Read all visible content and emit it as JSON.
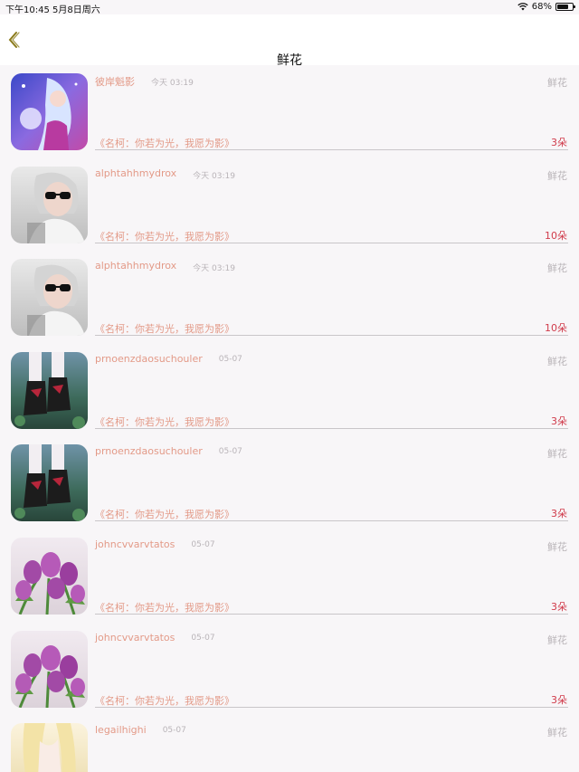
{
  "status_bar": {
    "time": "下午10:45  5月8日周六",
    "battery": "68%",
    "battery_level": 0.68
  },
  "nav": {
    "title": "鲜花",
    "back_icon": "chevron-left-icon",
    "accent_color": "#8a7a1a"
  },
  "colors": {
    "username": "#e39a88",
    "muted": "#b9b4b8",
    "count": "#d03a4a"
  },
  "items": [
    {
      "user": "彼岸魁影",
      "time": "今天 03:19",
      "gift": "鲜花",
      "message": "《名柯：你若为光，我愿为影》",
      "count": "3朵",
      "avatar": "anime-girl-avatar"
    },
    {
      "user": "alphtahhmydrox",
      "time": "今天 03:19",
      "gift": "鲜花",
      "message": "《名柯：你若为光，我愿为影》",
      "count": "10朵",
      "avatar": "sunglasses-boy-avatar"
    },
    {
      "user": "alphtahhmydrox",
      "time": "今天 03:19",
      "gift": "鲜花",
      "message": "《名柯：你若为光，我愿为影》",
      "count": "10朵",
      "avatar": "sunglasses-boy-avatar"
    },
    {
      "user": "prnoenzdaosuchouler",
      "time": "05-07",
      "gift": "鲜花",
      "message": "《名柯：你若为光，我愿为影》",
      "count": "3朵",
      "avatar": "boots-avatar"
    },
    {
      "user": "prnoenzdaosuchouler",
      "time": "05-07",
      "gift": "鲜花",
      "message": "《名柯：你若为光，我愿为影》",
      "count": "3朵",
      "avatar": "boots-avatar"
    },
    {
      "user": "johncvvarvtatos",
      "time": "05-07",
      "gift": "鲜花",
      "message": "《名柯：你若为光，我愿为影》",
      "count": "3朵",
      "avatar": "tulips-avatar"
    },
    {
      "user": "johncvvarvtatos",
      "time": "05-07",
      "gift": "鲜花",
      "message": "《名柯：你若为光，我愿为影》",
      "count": "3朵",
      "avatar": "tulips-avatar"
    },
    {
      "user": "legailhighi",
      "time": "05-07",
      "gift": "鲜花",
      "message": "",
      "count": "",
      "avatar": "blonde-anime-avatar"
    }
  ]
}
